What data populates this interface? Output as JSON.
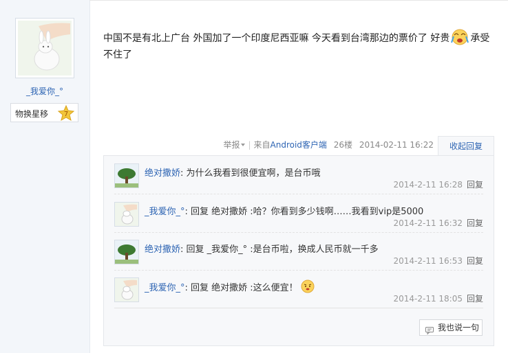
{
  "sidebar": {
    "username": "_我爱你_°",
    "badge_label": "物换星移",
    "badge_level": "7"
  },
  "post": {
    "text_before": "中国不是有北上广台 外国加了一个印度尼西亚嘛 今天看到台湾那边的票价了 好贵",
    "text_after": "承受不住了"
  },
  "meta": {
    "report": "举报",
    "source_prefix": "来自",
    "source_link": "Android客户端",
    "floor": "26楼",
    "datetime": "2014-02-11 16:22",
    "collapse": "收起回复"
  },
  "comments": [
    {
      "author": "绝对撒娇",
      "body": "为什么我看到很便宜啊，是台币哦",
      "time": "2014-2-11 16:28",
      "reply": "回复"
    },
    {
      "author": "_我爱你_°",
      "body": "回复 绝对撒娇 :哈？你看到多少钱啊……我看到vip是5000",
      "time": "2014-2-11 16:32",
      "reply": "回复"
    },
    {
      "author": "绝对撒娇",
      "body": "回复 _我爱你_° :是台币啦，换成人民币就一千多",
      "time": "2014-2-11 16:53",
      "reply": "回复"
    },
    {
      "author": "_我爱你_°",
      "body": "回复 绝对撒娇 :这么便宜！",
      "time": "2014-2-11 18:05",
      "reply": "回复"
    }
  ],
  "say_button": "我也说一句",
  "icons": {
    "emo_crying": "crying-emoticon",
    "emo_angry": "angry-emoticon",
    "say": "speech-icon",
    "star": "level-star-icon"
  }
}
